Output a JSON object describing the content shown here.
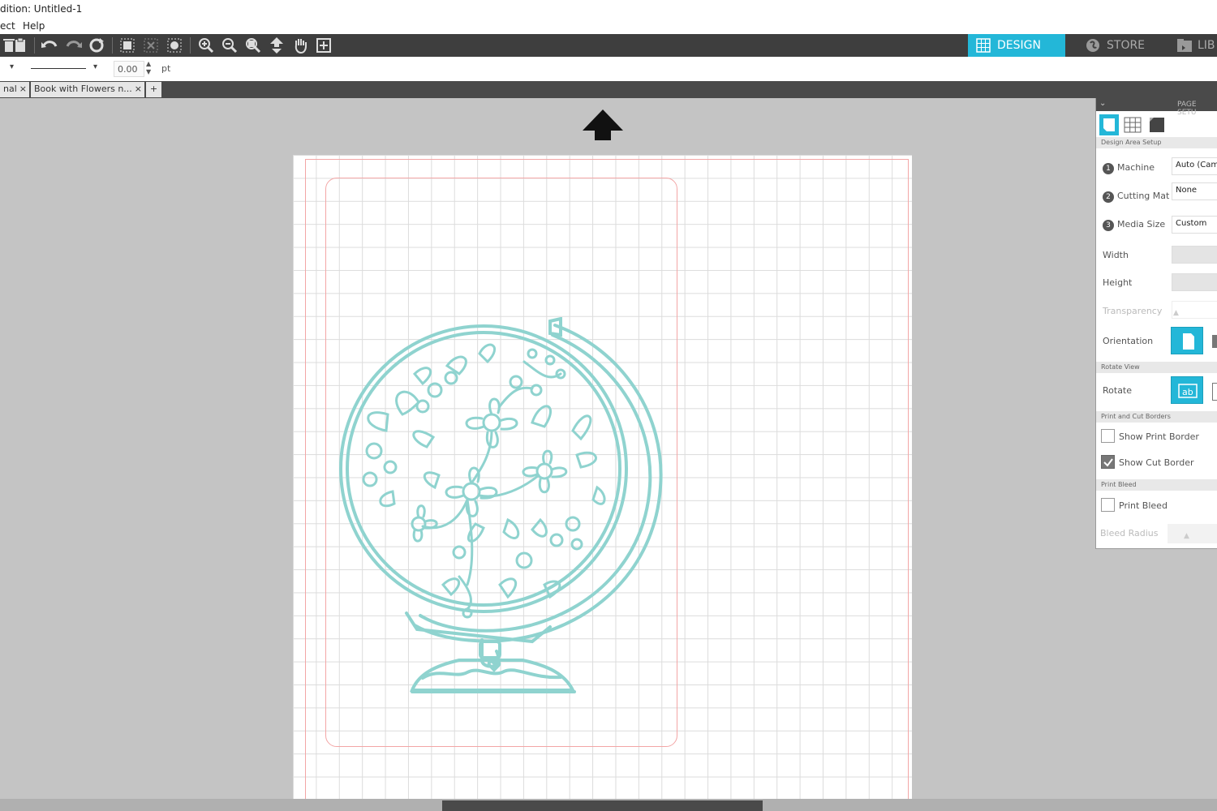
{
  "window": {
    "title": "dition: Untitled-1"
  },
  "menu": {
    "items": [
      "ect",
      "Help"
    ]
  },
  "top_tabs": [
    {
      "label": "DESIGN",
      "active": true
    },
    {
      "label": "STORE",
      "active": false
    },
    {
      "label": "LIB",
      "active": false
    }
  ],
  "line_options": {
    "thickness_value": "0.00",
    "unit": "pt",
    "style_arrow": "▾",
    "first_arrow": "▾"
  },
  "doc_tabs": [
    {
      "label": "nal",
      "close": "×"
    },
    {
      "label": "Book with Flowers n...",
      "close": "×"
    },
    {
      "label": "+"
    }
  ],
  "page_setup": {
    "title": "PAGE SETU",
    "section_design_area": "Design Area Setup",
    "machine": {
      "step": "1",
      "label": "Machine",
      "value": "Auto (Cam"
    },
    "cutting_mat": {
      "step": "2",
      "label": "Cutting Mat",
      "value": "None"
    },
    "media_size": {
      "step": "3",
      "label": "Media Size",
      "value": "Custom"
    },
    "width_label": "Width",
    "height_label": "Height",
    "transparency_label": "Transparency",
    "orientation_label": "Orientation",
    "section_rotate_view": "Rotate View",
    "rotate_label": "Rotate",
    "section_print_cut": "Print and Cut Borders",
    "show_print_border": {
      "label": "Show Print Border",
      "checked": false
    },
    "show_cut_border": {
      "label": "Show Cut Border",
      "checked": true
    },
    "section_print_bleed": "Print Bleed",
    "print_bleed": {
      "label": "Print Bleed",
      "checked": false
    },
    "bleed_radius_label": "Bleed Radius"
  },
  "colors": {
    "accent": "#23b7d8",
    "design_stroke": "#8fd3cf",
    "border_red": "#f3a6a6",
    "toolbar_bg": "#3e3e3e"
  }
}
